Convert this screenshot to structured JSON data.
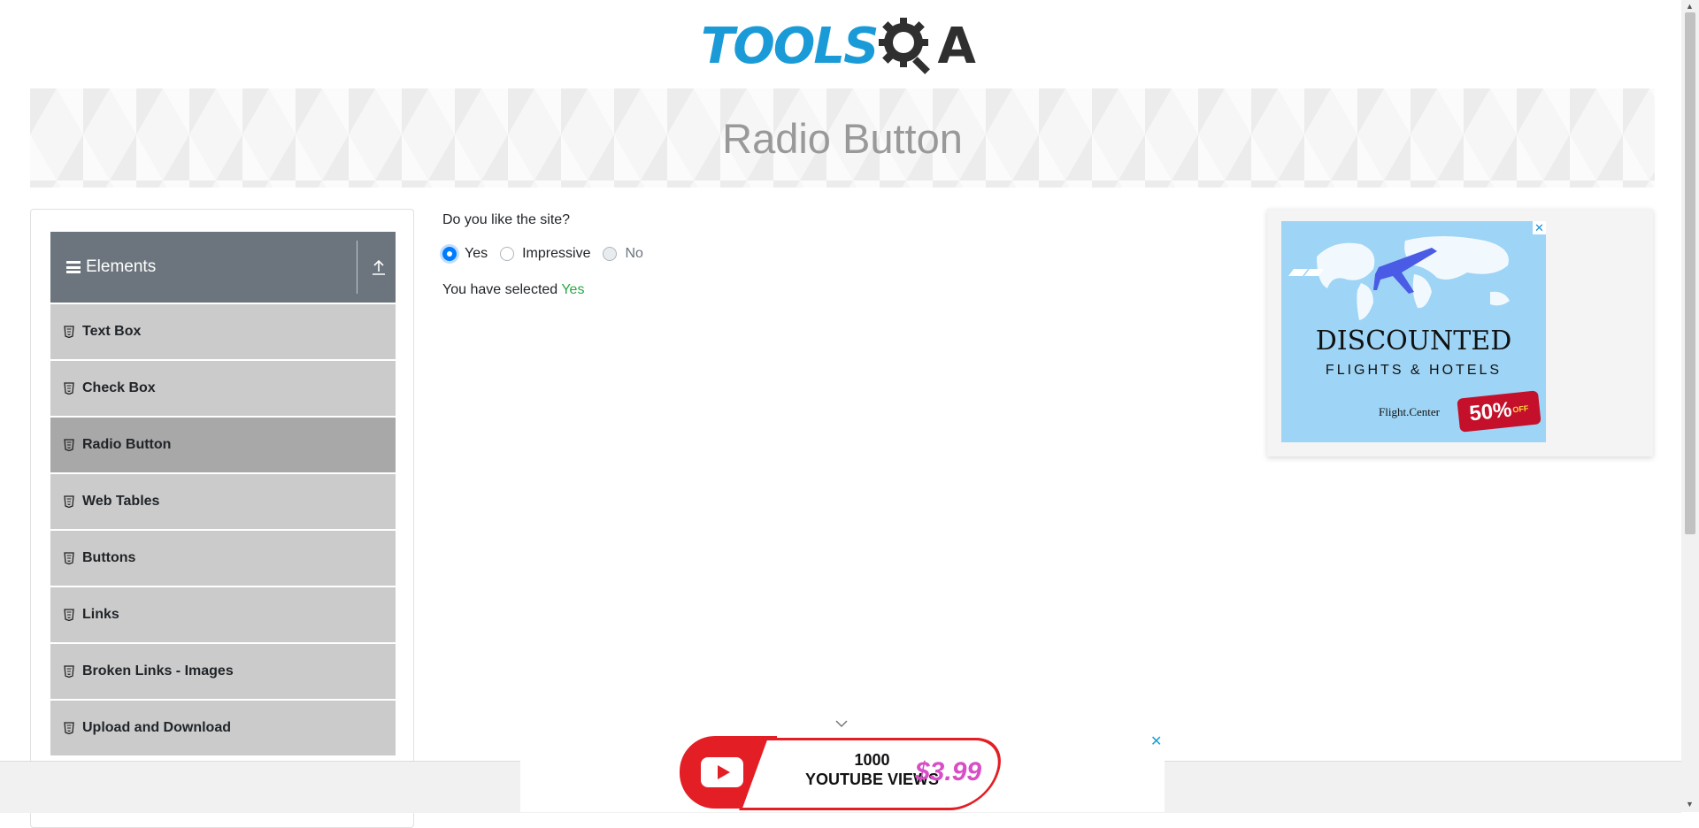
{
  "logo": {
    "part1": "TOOLS",
    "part2": "A",
    "colors": {
      "tools": "#1a9bd7",
      "gear": "#2f2f30"
    }
  },
  "banner": {
    "title": "Radio Button"
  },
  "sidebar": {
    "group_title": "Elements",
    "items": [
      {
        "label": "Text Box"
      },
      {
        "label": "Check Box"
      },
      {
        "label": "Radio Button",
        "active": true
      },
      {
        "label": "Web Tables"
      },
      {
        "label": "Buttons"
      },
      {
        "label": "Links"
      },
      {
        "label": "Broken Links - Images"
      },
      {
        "label": "Upload and Download"
      }
    ]
  },
  "main": {
    "question": "Do you like the site?",
    "options": [
      {
        "label": "Yes",
        "checked": true
      },
      {
        "label": "Impressive",
        "checked": false
      },
      {
        "label": "No",
        "checked": false,
        "disabled": true
      }
    ],
    "result_prefix": "You have selected",
    "result_value": "Yes"
  },
  "ad_right": {
    "title": "DISCOUNTED",
    "subtitle": "FLIGHTS & HOTELS",
    "brand": "Flight.Center",
    "discount": "50%",
    "discount_suffix": "OFF",
    "close": "✕"
  },
  "ad_bottom": {
    "line1": "1000",
    "line2": "YOUTUBE VIEWS",
    "price": "$3.99",
    "close": "✕"
  },
  "colors": {
    "accent": "#007bff",
    "success": "#28a745",
    "sidebar_header": "#6c757d",
    "menu_item": "#cbcbcb",
    "menu_active": "#a8a8a8"
  }
}
